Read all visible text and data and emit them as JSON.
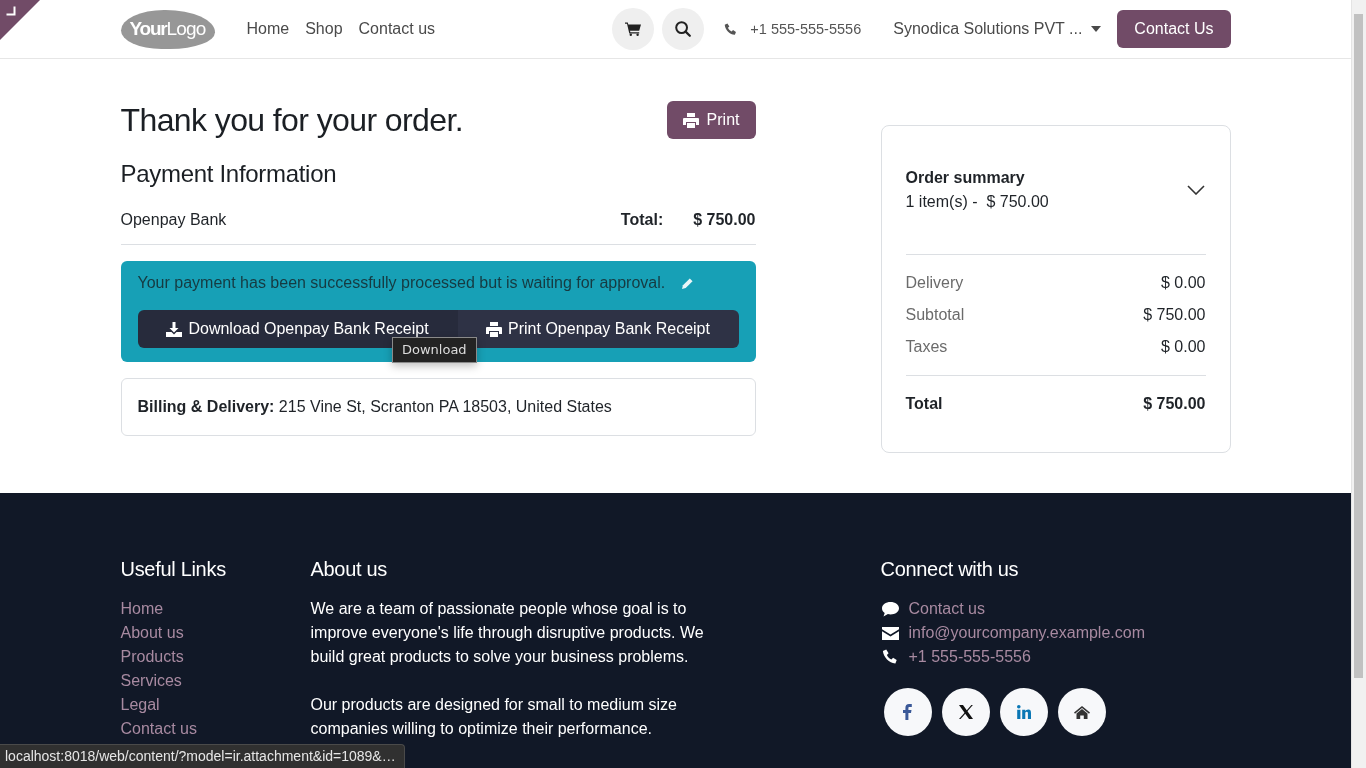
{
  "header": {
    "logo": "**Your**Logo",
    "nav": [
      "Home",
      "Shop",
      "Contact us"
    ],
    "phone": "+1 555-555-5556",
    "company": "Synodica Solutions PVT ...",
    "cta": "Contact Us"
  },
  "confirmation": {
    "title": "Thank you for your order.",
    "print": "Print",
    "payment_heading": "Payment Information",
    "payment_method": "Openpay Bank",
    "total_label": "Total:",
    "total_value": "$ 750.00",
    "alert": {
      "message": "Your payment has been successfully processed but is waiting for approval.",
      "buttons": [
        {
          "kind": "download",
          "label": "Download Openpay Bank Receipt"
        },
        {
          "kind": "print",
          "label": "Print Openpay Bank Receipt"
        }
      ]
    },
    "address": "**Billing & Delivery:** 215 Vine St, Scranton PA 18503, United States"
  },
  "tooltip": "Download",
  "order_summary": {
    "title": "Order summary",
    "items": "1 item(s) -  $ 750.00",
    "expanded": false,
    "lines": [
      {
        "label": "Delivery",
        "value": "$ 0.00"
      },
      {
        "label": "Subtotal",
        "value": "$ 750.00"
      },
      {
        "label": "Taxes",
        "value": "$ 0.00"
      }
    ],
    "total": {
      "label": "Total",
      "value": "$ 750.00"
    }
  },
  "footer": {
    "useful_links": {
      "title": "Useful Links",
      "links": [
        "Home",
        "About us",
        "Products",
        "Services",
        "Legal",
        "Contact us"
      ]
    },
    "about": {
      "title": "About us",
      "paragraphs": [
        "We are a team of passionate people whose goal is to improve everyone's life through disruptive products. We build great products to solve your business problems.",
        "Our products are designed for small to medium size companies willing to optimize their performance."
      ]
    },
    "connect": {
      "title": "Connect with us",
      "contacts": [
        {
          "kind": "chat",
          "text": "Contact us"
        },
        {
          "kind": "email",
          "text": "info@yourcompany.example.com"
        },
        {
          "kind": "phone",
          "text": "+1 555-555-5556"
        }
      ],
      "social": [
        {
          "kind": "facebook"
        },
        {
          "kind": "x"
        },
        {
          "kind": "linkedin"
        },
        {
          "kind": "home"
        }
      ]
    }
  },
  "status_bar": {
    "url": "localhost:8018/web/content/?model=ir.attachment&id=1089&…"
  }
}
